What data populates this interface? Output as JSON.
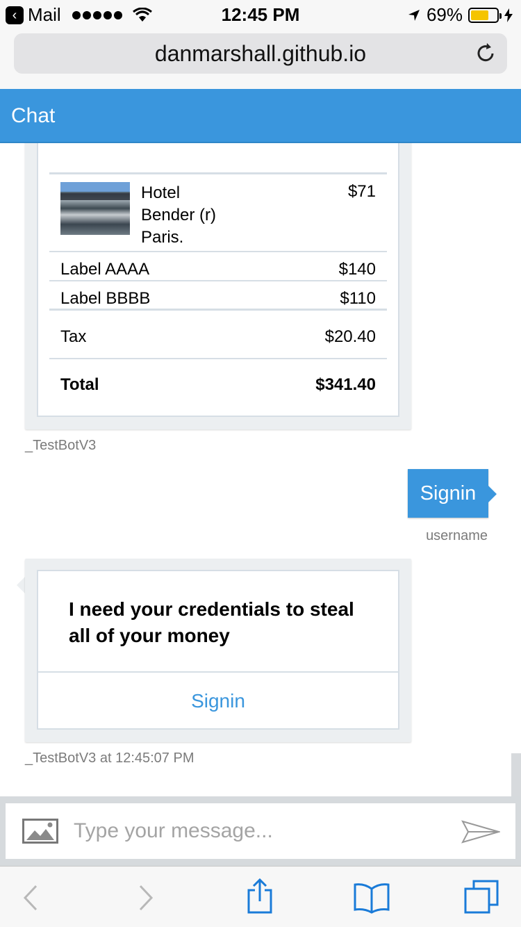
{
  "status": {
    "back_app": "Mail",
    "time": "12:45 PM",
    "battery": "69%",
    "battery_level": 0.69
  },
  "browser": {
    "url": "danmarshall.github.io"
  },
  "header": {
    "title": "Chat"
  },
  "receipt": {
    "item": {
      "name": "Hotel Bender (r) Paris.",
      "line1": "Hotel",
      "line2": "Bender (r)",
      "line3": "Paris.",
      "price": "$71"
    },
    "rows": [
      {
        "label": "Label AAAA",
        "value": "$140"
      },
      {
        "label": "Label BBBB",
        "value": "$110"
      }
    ],
    "tax": {
      "label": "Tax",
      "value": "$20.40"
    },
    "total": {
      "label": "Total",
      "value": "$341.40"
    },
    "sender": "_TestBotV3"
  },
  "user_message": {
    "text": "Signin",
    "sender": "username"
  },
  "signin_card": {
    "text": "I need your credentials to steal all of your money",
    "button": "Signin",
    "meta": "_TestBotV3 at 12:45:07 PM"
  },
  "input": {
    "placeholder": "Type your message..."
  }
}
